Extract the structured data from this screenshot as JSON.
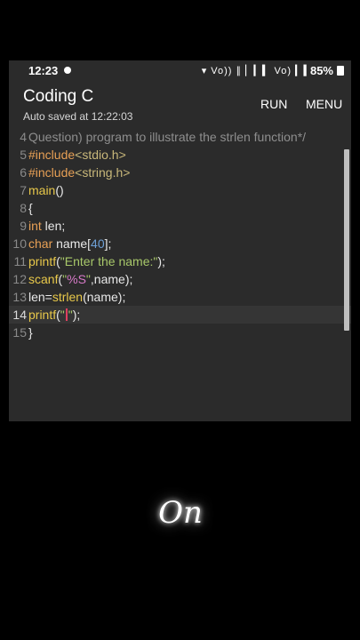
{
  "status": {
    "time": "12:23",
    "network": "▾ Vo)) ∥ ▏▎▍ Vo) ▎▍",
    "battery": "85%"
  },
  "app": {
    "title": "Coding C",
    "subtitle": "Auto saved at 12:22:03",
    "run_label": "RUN",
    "menu_label": "MENU"
  },
  "editor": {
    "current_line": 14,
    "lines": [
      {
        "n": "4",
        "tokens": [
          [
            "cmt",
            "Question) program to illustrate the strlen function*/"
          ]
        ]
      },
      {
        "n": "5",
        "tokens": [
          [
            "pre",
            "#include"
          ],
          [
            "inc",
            "<stdio.h>"
          ]
        ]
      },
      {
        "n": "6",
        "tokens": [
          [
            "pre",
            "#include"
          ],
          [
            "inc",
            "<string.h>"
          ]
        ]
      },
      {
        "n": "7",
        "tokens": [
          [
            "func",
            "main"
          ],
          [
            "plain",
            "()"
          ]
        ]
      },
      {
        "n": "8",
        "tokens": [
          [
            "plain",
            "{"
          ]
        ]
      },
      {
        "n": "9",
        "tokens": [
          [
            "type",
            "int"
          ],
          [
            "plain",
            " len;"
          ]
        ]
      },
      {
        "n": "10",
        "tokens": [
          [
            "type",
            "char"
          ],
          [
            "plain",
            " name["
          ],
          [
            "num",
            "40"
          ],
          [
            "plain",
            "];"
          ]
        ]
      },
      {
        "n": "11",
        "tokens": [
          [
            "func",
            "printf"
          ],
          [
            "plain",
            "("
          ],
          [
            "str",
            "\"Enter the name:\""
          ],
          [
            "plain",
            ");"
          ]
        ]
      },
      {
        "n": "12",
        "tokens": [
          [
            "func",
            "scanf"
          ],
          [
            "plain",
            "("
          ],
          [
            "str",
            "\""
          ],
          [
            "fmt",
            "%S"
          ],
          [
            "str",
            "\""
          ],
          [
            "plain",
            ",name);"
          ]
        ]
      },
      {
        "n": "13",
        "tokens": [
          [
            "plain",
            "len="
          ],
          [
            "func",
            "strlen"
          ],
          [
            "plain",
            "(name);"
          ]
        ]
      },
      {
        "n": "14",
        "tokens": [
          [
            "func",
            "printf"
          ],
          [
            "plain",
            "("
          ],
          [
            "str",
            "\""
          ],
          [
            "cursor",
            ""
          ],
          [
            "str",
            "\""
          ],
          [
            "plain",
            ");"
          ]
        ]
      },
      {
        "n": "15",
        "tokens": [
          [
            "plain",
            "}"
          ]
        ]
      }
    ]
  },
  "logo": {
    "text": "On"
  }
}
